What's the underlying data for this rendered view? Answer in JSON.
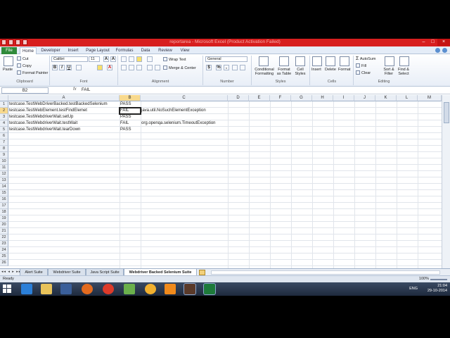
{
  "window": {
    "title": "reportarea - Microsoft Excel (Product Activation Failed)"
  },
  "ribbon_tabs": [
    "File",
    "Home",
    "Developer",
    "Insert",
    "Page Layout",
    "Formulas",
    "Data",
    "Review",
    "View"
  ],
  "active_tab": "Home",
  "ribbon": {
    "clipboard": {
      "paste": "Paste",
      "cut": "Cut",
      "copy": "Copy",
      "format_painter": "Format Painter",
      "label": "Clipboard"
    },
    "font": {
      "name": "Calibri",
      "size": "11",
      "label": "Font",
      "bold": "B",
      "italic": "I",
      "underline": "U"
    },
    "alignment": {
      "wrap_text": "Wrap Text",
      "merge_center": "Merge & Center",
      "label": "Alignment"
    },
    "number": {
      "format": "General",
      "percent": "%",
      "comma": ",",
      "label": "Number"
    },
    "styles": {
      "conditional_formatting": "Conditional Formatting",
      "format_as_table": "Format as Table",
      "cell_styles": "Cell Styles",
      "label": "Styles"
    },
    "cells": {
      "insert": "Insert",
      "delete": "Delete",
      "format": "Format",
      "label": "Cells"
    },
    "editing": {
      "autosum": "AutoSum",
      "fill": "Fill",
      "clear": "Clear",
      "sort_filter": "Sort & Filter",
      "find_select": "Find & Select",
      "label": "Editing"
    }
  },
  "formula_bar": {
    "name_box": "B2",
    "fx": "fx",
    "content": "FAIL"
  },
  "columns": [
    "A",
    "B",
    "C",
    "D",
    "E",
    "F",
    "G",
    "H",
    "I",
    "J",
    "K",
    "L",
    "M"
  ],
  "rows": [
    "1",
    "2",
    "3",
    "4",
    "5",
    "6",
    "7",
    "8",
    "9",
    "10",
    "11",
    "12",
    "13",
    "14",
    "15",
    "16",
    "17",
    "18",
    "19",
    "20",
    "21",
    "22",
    "23",
    "24",
    "25",
    "26"
  ],
  "cells": [
    [
      "testcase.TestWebDriverBacked.testBackedSelenium",
      "PASS",
      ""
    ],
    [
      "testcase.TestWebElement.testFindElemet",
      "FAIL",
      "java.util.NoSuchElementException"
    ],
    [
      "testcase.TestWebdriverWait.setUp",
      "PASS",
      ""
    ],
    [
      "testcase.TestWebdriverWait.testWait",
      "FAIL",
      "org.openqa.selenium.TimeoutException"
    ],
    [
      "testcase.TestWebdriverWait.tearDown",
      "PASS",
      ""
    ]
  ],
  "selected_cell": "B2",
  "sheet_tabs": [
    "Alert Suite",
    "Webdriver Suite",
    "Java Script Suite",
    "Webdriver Backed Selenium Suite"
  ],
  "active_sheet": "Webdriver Backed Selenium Suite",
  "status": {
    "ready": "Ready",
    "zoom": "100%"
  },
  "taskbar": {
    "apps": [
      "ie-icon",
      "explorer-icon",
      "media-icon",
      "firefox-icon",
      "chrome-icon",
      "notepad-icon",
      "paint-icon",
      "vlc-icon",
      "app-icon",
      "excel-icon"
    ],
    "lang": "ENG",
    "time": "21:04",
    "date": "29-10-2014"
  },
  "colors": {
    "titlebar": "#d71e1e",
    "file_tab": "#2f8a3a",
    "selected_header": "#f8d98d"
  }
}
